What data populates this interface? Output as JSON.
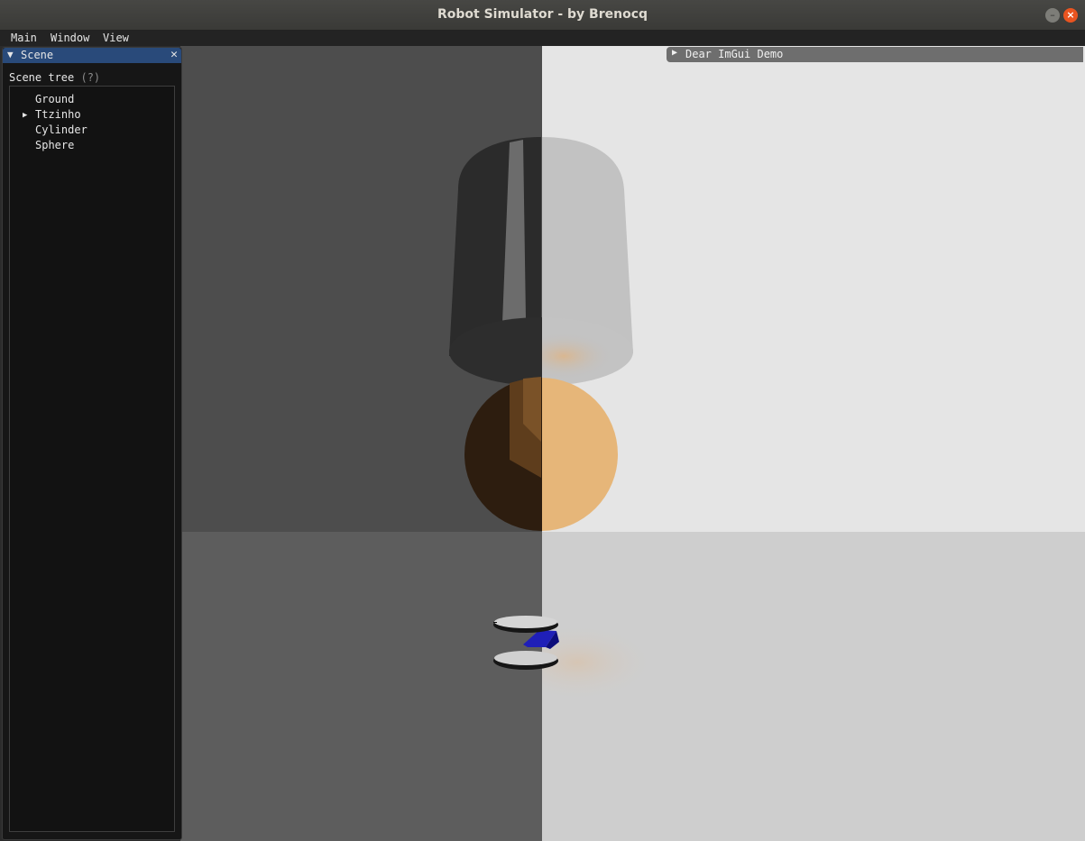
{
  "window": {
    "title": "Robot Simulator - by Brenocq",
    "minimize_icon": "minimize-icon",
    "close_icon": "close-icon"
  },
  "menubar": {
    "items": [
      "Main",
      "Window",
      "View"
    ]
  },
  "scene_panel": {
    "title": "Scene",
    "collapse_icon": "triangle-down-icon",
    "close_icon": "close-x-icon",
    "tree_label": "Scene tree",
    "help_marker": "(?)",
    "tree_items": [
      {
        "label": "Ground",
        "expandable": false
      },
      {
        "label": "Ttzinho",
        "expandable": true
      },
      {
        "label": "Cylinder",
        "expandable": false
      },
      {
        "label": "Sphere",
        "expandable": false
      }
    ]
  },
  "demo_window": {
    "title": "Dear ImGui Demo",
    "collapsed_icon": "triangle-right-icon"
  },
  "colors": {
    "panel_header": "#294a7a",
    "sphere": "#e6b679",
    "robot_body": "#1f1fb8",
    "close_button": "#e95420"
  }
}
